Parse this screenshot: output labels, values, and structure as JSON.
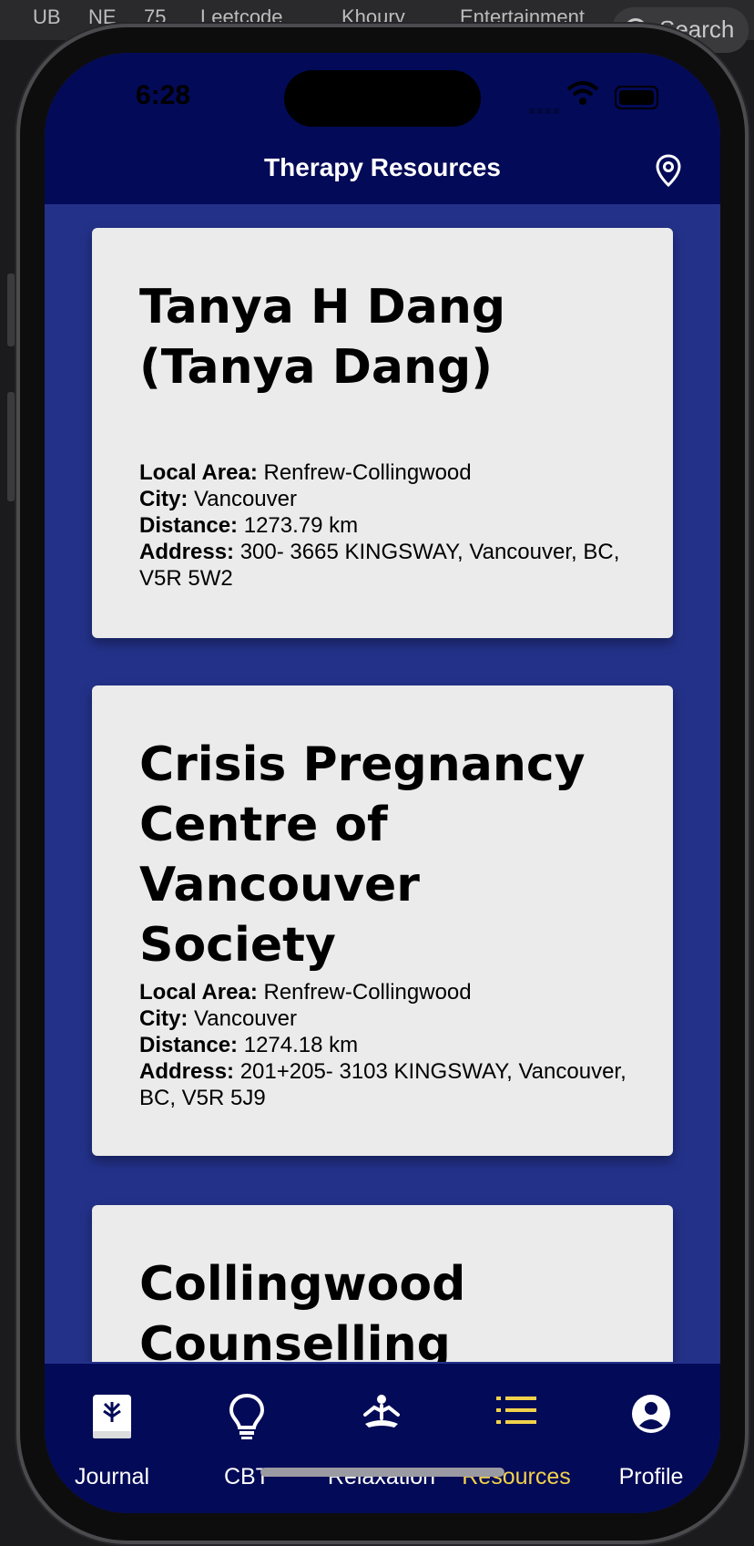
{
  "browser": {
    "bookmarks": [
      "UB",
      "NE",
      "75",
      "Leetcode",
      "Khoury",
      "Entertainment"
    ],
    "search_label": "Search"
  },
  "status_bar": {
    "time": "6:28"
  },
  "header": {
    "title": "Therapy Resources"
  },
  "labels": {
    "local_area": "Local Area:",
    "city": "City:",
    "distance": "Distance:",
    "address": "Address:"
  },
  "resources": [
    {
      "name": "Tanya H Dang (Tanya Dang)",
      "local_area": "Renfrew-Collingwood",
      "city": "Vancouver",
      "distance": "1273.79 km",
      "address": "300- 3665 KINGSWAY, Vancouver, BC, V5R 5W2"
    },
    {
      "name": "Crisis Pregnancy Centre of Vancouver Society",
      "local_area": "Renfrew-Collingwood",
      "city": "Vancouver",
      "distance": "1274.18 km",
      "address": "201+205- 3103 KINGSWAY, Vancouver, BC, V5R 5J9"
    },
    {
      "name": "Collingwood Counselling Center"
    }
  ],
  "tabs": [
    {
      "label": "Journal",
      "icon": "journal-icon",
      "active": false
    },
    {
      "label": "CBT",
      "icon": "lightbulb-icon",
      "active": false
    },
    {
      "label": "Relaxation",
      "icon": "meditation-icon",
      "active": false
    },
    {
      "label": "Resources",
      "icon": "list-icon",
      "active": true
    },
    {
      "label": "Profile",
      "icon": "profile-icon",
      "active": false
    }
  ],
  "colors": {
    "header_bg": "#030a57",
    "content_bg": "#233189",
    "card_bg": "#ebebeb",
    "active_tab": "#f2d24c"
  }
}
